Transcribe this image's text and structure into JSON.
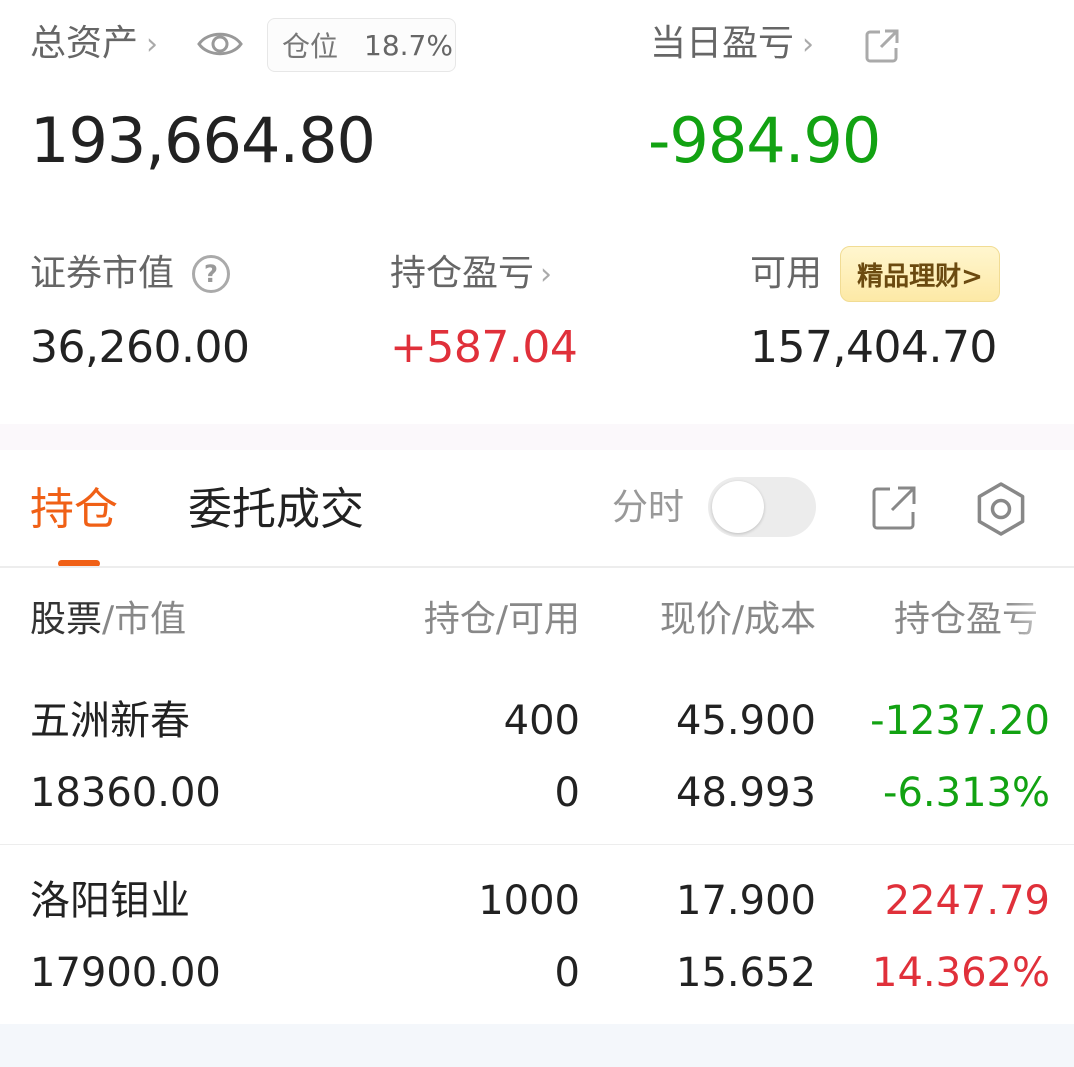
{
  "summary": {
    "total_assets_label": "总资产",
    "position_label": "仓位",
    "position_value": "18.7%",
    "total_assets_value": "193,664.80",
    "daily_pl_label": "当日盈亏",
    "daily_pl_value": "-984.90",
    "market_value_label": "证券市值",
    "market_value_value": "36,260.00",
    "holding_pl_label": "持仓盈亏",
    "holding_pl_value": "+587.04",
    "available_label": "可用",
    "finance_badge": "精品理财>",
    "available_value": "157,404.70"
  },
  "tabs": {
    "holdings": "持仓",
    "orders": "委托成交",
    "timeshare_label": "分时",
    "timeshare_on": false
  },
  "table": {
    "headers": {
      "stock": "股票",
      "market_value": "/市值",
      "holding": "持仓/可用",
      "price": "现价/成本",
      "pl": "持仓盈亏"
    },
    "rows": [
      {
        "name": "五洲新春",
        "market_value": "18360.00",
        "holding": "400",
        "available": "0",
        "price": "45.900",
        "cost": "48.993",
        "pl": "-1237.20",
        "pl_pct": "-6.313%"
      },
      {
        "name": "洛阳钼业",
        "market_value": "17900.00",
        "holding": "1000",
        "available": "0",
        "price": "17.900",
        "cost": "15.652",
        "pl": "2247.79",
        "pl_pct": "14.362%"
      }
    ]
  },
  "colors": {
    "accent": "#f06016",
    "loss": "#12a212",
    "gain": "#e0303a"
  }
}
